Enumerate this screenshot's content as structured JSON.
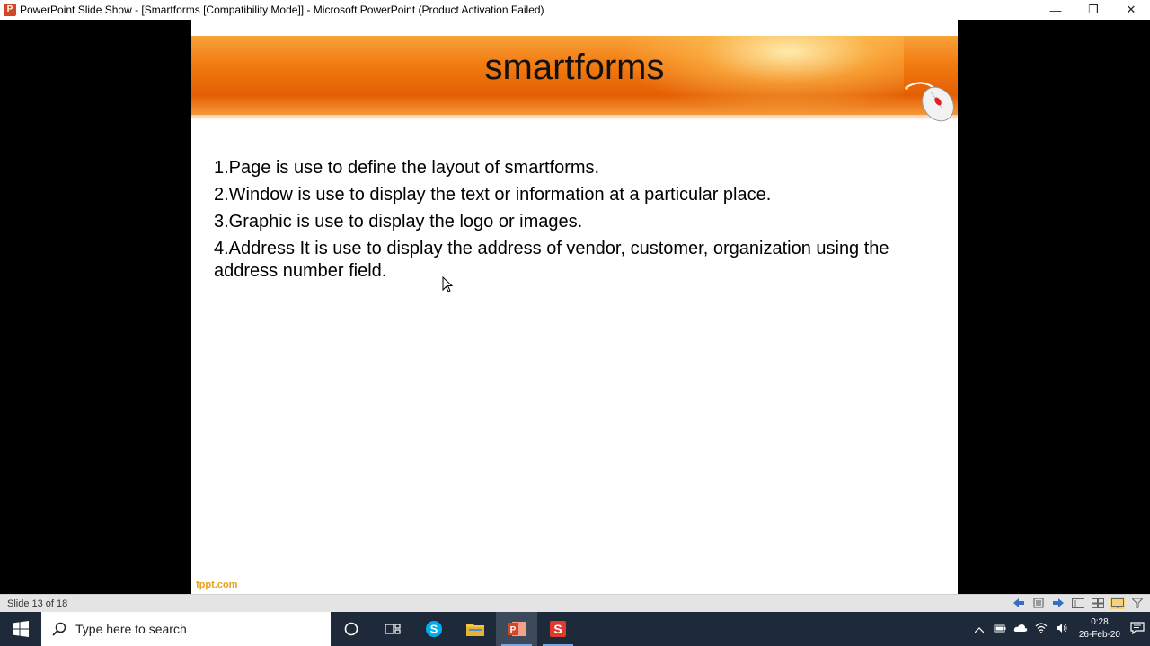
{
  "window": {
    "app_icon_letter": "P",
    "title": "PowerPoint Slide Show - [Smartforms [Compatibility Mode]] - Microsoft PowerPoint (Product Activation Failed)",
    "minimize": "—",
    "restore": "❐",
    "close": "✕"
  },
  "slide": {
    "title": "smartforms",
    "points": [
      "1.Page is use to define the layout of smartforms.",
      "2.Window is use to display the text or information at a particular place.",
      "3.Graphic is use to display the logo or images.",
      "4.Address It is use to display the address of vendor, customer, organization using the address number  field."
    ],
    "footer_logo": "fppt.com"
  },
  "status": {
    "slide_indicator": "Slide 13 of 18"
  },
  "taskbar": {
    "search_placeholder": "Type here to search",
    "clock_time": "0:28",
    "clock_date": "26-Feb-20"
  },
  "colors": {
    "header_orange": "#f27c12",
    "taskbar_bg": "#1e2a3a",
    "footer_logo": "#e8a11c"
  }
}
